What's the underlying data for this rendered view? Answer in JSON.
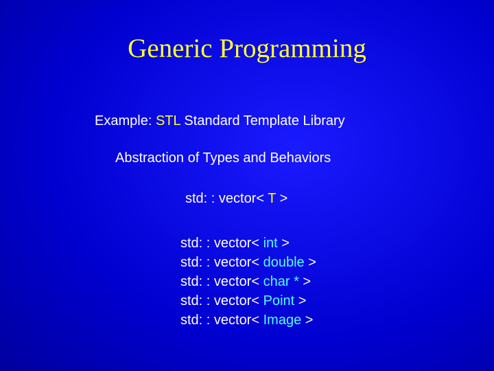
{
  "title": "Generic Programming",
  "subtitle_prefix": "Example: ",
  "subtitle_highlight": "STL",
  "subtitle_suffix": "  Standard Template Library",
  "abstraction": "Abstraction of Types and Behaviors",
  "generic_prefix": "std: : vector< ",
  "generic_template": "T",
  "generic_suffix": " >",
  "instances": [
    {
      "prefix": "std: : vector< ",
      "type": "int",
      "suffix": " >"
    },
    {
      "prefix": "std: : vector< ",
      "type": "double",
      "suffix": " >"
    },
    {
      "prefix": "std: : vector< ",
      "type": "char *",
      "suffix": " >"
    },
    {
      "prefix": "std: : vector< ",
      "type": "Point",
      "suffix": " >"
    },
    {
      "prefix": "std: : vector< ",
      "type": "Image",
      "suffix": " >"
    }
  ]
}
